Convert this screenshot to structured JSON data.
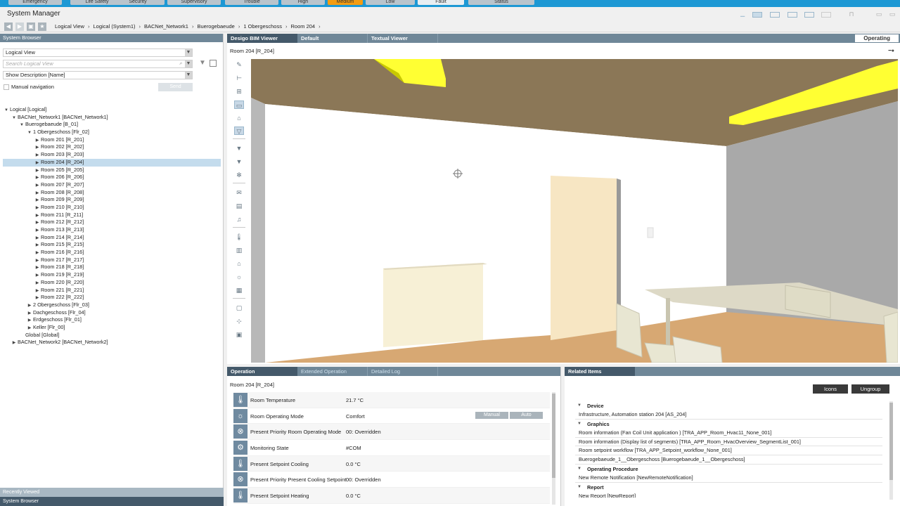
{
  "alarm_bar": {
    "buttons": [
      {
        "label": "Emergency"
      },
      {
        "label": "Life Safety"
      },
      {
        "label": "Security"
      },
      {
        "label": "Supervisory"
      },
      {
        "label": "Trouble"
      },
      {
        "label": "High"
      },
      {
        "label": "Medium",
        "color": "#f39c12"
      },
      {
        "label": "Low"
      },
      {
        "label": "Fault"
      },
      {
        "label": "Status"
      }
    ]
  },
  "app": {
    "title": "System Manager"
  },
  "breadcrumb": [
    "Logical View",
    "Logical (System1)",
    "BACNet_Network1",
    "Buerogebaeude",
    "1 Obergeschoss",
    "Room 204"
  ],
  "system_browser": {
    "title": "System Browser",
    "view_select": "Logical View",
    "search_placeholder": "Search Logical View",
    "description_select": "Show Description [Name]",
    "manual_navigation": "Manual navigation",
    "send_label": "Send",
    "tree": [
      {
        "label": "Logical [Logical]",
        "level": 0,
        "state": "open"
      },
      {
        "label": "BACNet_Network1 [BACNet_Network1]",
        "level": 1,
        "state": "open"
      },
      {
        "label": "Buerogebaeude [B_01]",
        "level": 2,
        "state": "open"
      },
      {
        "label": "1 Obergeschoss [Flr_02]",
        "level": 3,
        "state": "open"
      },
      {
        "label": "Room 201 [R_201]",
        "level": 4,
        "state": "closed"
      },
      {
        "label": "Room 202 [R_202]",
        "level": 4,
        "state": "closed"
      },
      {
        "label": "Room 203 [R_203]",
        "level": 4,
        "state": "closed"
      },
      {
        "label": "Room 204 [R_204]",
        "level": 4,
        "state": "closed",
        "selected": true
      },
      {
        "label": "Room 205 [R_205]",
        "level": 4,
        "state": "closed"
      },
      {
        "label": "Room 206 [R_206]",
        "level": 4,
        "state": "closed"
      },
      {
        "label": "Room 207 [R_207]",
        "level": 4,
        "state": "closed"
      },
      {
        "label": "Room 208 [R_208]",
        "level": 4,
        "state": "closed"
      },
      {
        "label": "Room 209 [R_209]",
        "level": 4,
        "state": "closed"
      },
      {
        "label": "Room 210 [R_210]",
        "level": 4,
        "state": "closed"
      },
      {
        "label": "Room 211 [R_211]",
        "level": 4,
        "state": "closed"
      },
      {
        "label": "Room 212 [R_212]",
        "level": 4,
        "state": "closed"
      },
      {
        "label": "Room 213 [R_213]",
        "level": 4,
        "state": "closed"
      },
      {
        "label": "Room 214 [R_214]",
        "level": 4,
        "state": "closed"
      },
      {
        "label": "Room 215 [R_215]",
        "level": 4,
        "state": "closed"
      },
      {
        "label": "Room 216 [R_216]",
        "level": 4,
        "state": "closed"
      },
      {
        "label": "Room 217 [R_217]",
        "level": 4,
        "state": "closed"
      },
      {
        "label": "Room 218 [R_218]",
        "level": 4,
        "state": "closed"
      },
      {
        "label": "Room 219 [R_219]",
        "level": 4,
        "state": "closed"
      },
      {
        "label": "Room 220 [R_220]",
        "level": 4,
        "state": "closed"
      },
      {
        "label": "Room 221 [R_221]",
        "level": 4,
        "state": "closed"
      },
      {
        "label": "Room 222 [R_222]",
        "level": 4,
        "state": "closed"
      },
      {
        "label": "2 Obergeschoss [Flr_03]",
        "level": 3,
        "state": "closed"
      },
      {
        "label": "Dachgeschoss [Flr_04]",
        "level": 3,
        "state": "closed"
      },
      {
        "label": "Erdgeschoss [Flr_01]",
        "level": 3,
        "state": "closed"
      },
      {
        "label": "Keller [Flr_00]",
        "level": 3,
        "state": "closed"
      },
      {
        "label": "Global [Global]",
        "level": 2,
        "state": "none"
      },
      {
        "label": "BACNet_Network2 [BACNet_Network2]",
        "level": 1,
        "state": "closed"
      }
    ],
    "footer_tabs": [
      {
        "label": "Recently Viewed",
        "color": "#a9b8c3"
      },
      {
        "label": "System Browser",
        "color": "#44596a"
      }
    ]
  },
  "viewer": {
    "tabs": [
      "Desigo BIM Viewer",
      "Default",
      "Textual Viewer"
    ],
    "mode": "Operating",
    "room": "Room 204 [R_204]",
    "tools": [
      "pencil-icon",
      "hierarchy-icon",
      "grid-icon",
      "floorplan-icon",
      "home-icon",
      "filter-icon",
      "filter-1-icon",
      "filter-2-icon",
      "fan-icon",
      "chat-icon",
      "panel-icon",
      "bell-icon",
      "thermometer-icon",
      "blind-icon",
      "building-icon",
      "bulb-icon",
      "door-icon",
      "document-icon",
      "network-icon",
      "screen-icon"
    ]
  },
  "operation": {
    "tabs": [
      "Operation",
      "Extended Operation",
      "Detailed Log"
    ],
    "room": "Room 204 [R_204]",
    "rows": [
      {
        "label": "Room Temperature",
        "value": "21.7 °C",
        "icon": "thermometer-icon"
      },
      {
        "label": "Room Operating Mode",
        "value": "Comfort",
        "icon": "sun-icon",
        "buttons": [
          "Manual",
          "Auto"
        ]
      },
      {
        "label": "Present Priority Room Operating Mode",
        "value": "00: Overridden",
        "icon": "priority-icon"
      },
      {
        "label": "Monitoring State",
        "value": "#COM",
        "icon": "gears-icon"
      },
      {
        "label": "Present Setpoint Cooling",
        "value": "0.0 °C",
        "icon": "thermometer-icon"
      },
      {
        "label": "Present Priority Present Cooling Setpoint",
        "value": "00: Overridden",
        "icon": "priority-icon"
      },
      {
        "label": "Present Setpoint Heating",
        "value": "0.0 °C",
        "icon": "thermometer-icon"
      }
    ]
  },
  "related_items": {
    "title": "Related Items",
    "icons_label": "Icons",
    "ungroup_label": "Ungroup",
    "groups": [
      {
        "name": "Device",
        "items": [
          "Infrastructure, Automation station 204 [AS_204]"
        ]
      },
      {
        "name": "Graphics",
        "items": [
          "Room information (Fan Coil Unit application ) [TRA_APP_Room_Hvac11_None_001]",
          "Room information (Display list of segments) [TRA_APP_Room_HvacOverview_SegmentList_001]",
          "Room setpoint workflow [TRA_APP_Setpoint_workflow_None_001]",
          "Buerogebaeude_1__Obergeschoss [Buerogebaeude_1__Obergeschoss]"
        ]
      },
      {
        "name": "Operating Procedure",
        "items": [
          "New Remote Notification [NewRemoteNotification]"
        ]
      },
      {
        "name": "Report",
        "items": [
          "New Report [NewReport]"
        ]
      }
    ]
  }
}
